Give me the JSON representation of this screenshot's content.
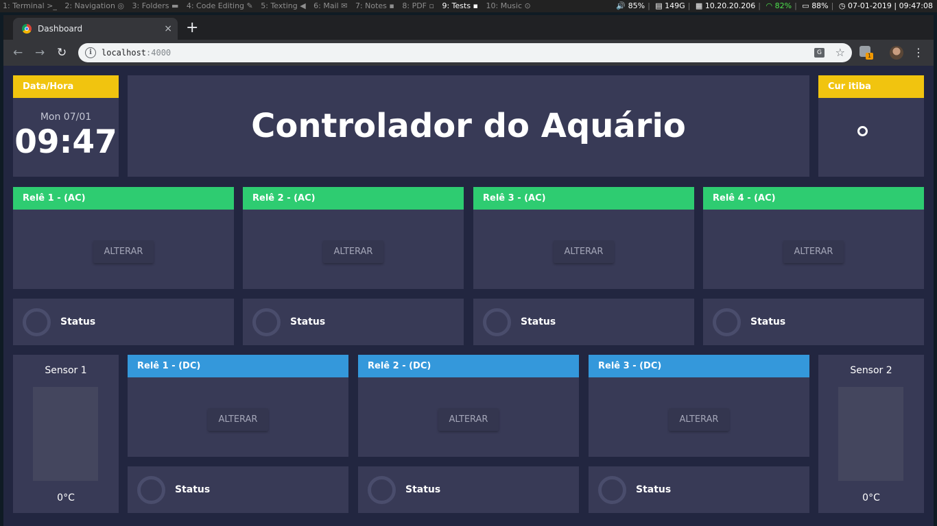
{
  "system_bar": {
    "workspaces": [
      "1: Terminal >_",
      "2: Navigation ◎",
      "3: Folders ▬",
      "4: Code Editing ✎",
      "5: Texting ◀",
      "6: Mail ✉",
      "7: Notes ▪",
      "8: PDF ▫",
      "9: Tests ▪",
      "10: Music ⊙"
    ],
    "active_workspace_index": 8,
    "volume": "🔊 85%",
    "disk": "149G",
    "ip": "10.20.20.206",
    "wifi": "82%",
    "battery": "88%",
    "datetime": "07-01-2019 | 09:47:08"
  },
  "browser": {
    "tab_title": "Dashboard",
    "tab_close": "×",
    "new_tab": "+",
    "url_host": "localhost",
    "url_port": ":4000",
    "extension_badge": "1",
    "icons": {
      "back": "←",
      "forward": "→",
      "reload": "↻",
      "info": "i",
      "translate": "G",
      "star": "☆",
      "menu": "⋮"
    }
  },
  "dashboard": {
    "datetime_card": {
      "header": "Data/Hora",
      "date": "Mon 07/01",
      "time": "09:47"
    },
    "title": "Controlador do Aquário",
    "weather_card": {
      "header": "Cur itiba",
      "icon": "degree-ring-icon"
    },
    "relays_ac": [
      {
        "header": "Relê 1 - (AC)",
        "button": "ALTERAR",
        "status": "Status"
      },
      {
        "header": "Relê 2 - (AC)",
        "button": "ALTERAR",
        "status": "Status"
      },
      {
        "header": "Relê 3 - (AC)",
        "button": "ALTERAR",
        "status": "Status"
      },
      {
        "header": "Relê 4 - (AC)",
        "button": "ALTERAR",
        "status": "Status"
      }
    ],
    "relays_dc": [
      {
        "header": "Relê 1 - (DC)",
        "button": "ALTERAR",
        "status": "Status"
      },
      {
        "header": "Relê 2 - (DC)",
        "button": "ALTERAR",
        "status": "Status"
      },
      {
        "header": "Relê 3 - (DC)",
        "button": "ALTERAR",
        "status": "Status"
      }
    ],
    "sensors": [
      {
        "name": "Sensor 1",
        "value": "0°C",
        "level": 0
      },
      {
        "name": "Sensor 2",
        "value": "0°C",
        "level": 0
      }
    ],
    "colors": {
      "page_bg": "#222640",
      "card_bg": "#383a56",
      "header_yellow": "#f1c40f",
      "header_green": "#2ecc71",
      "header_blue": "#3498db"
    }
  }
}
